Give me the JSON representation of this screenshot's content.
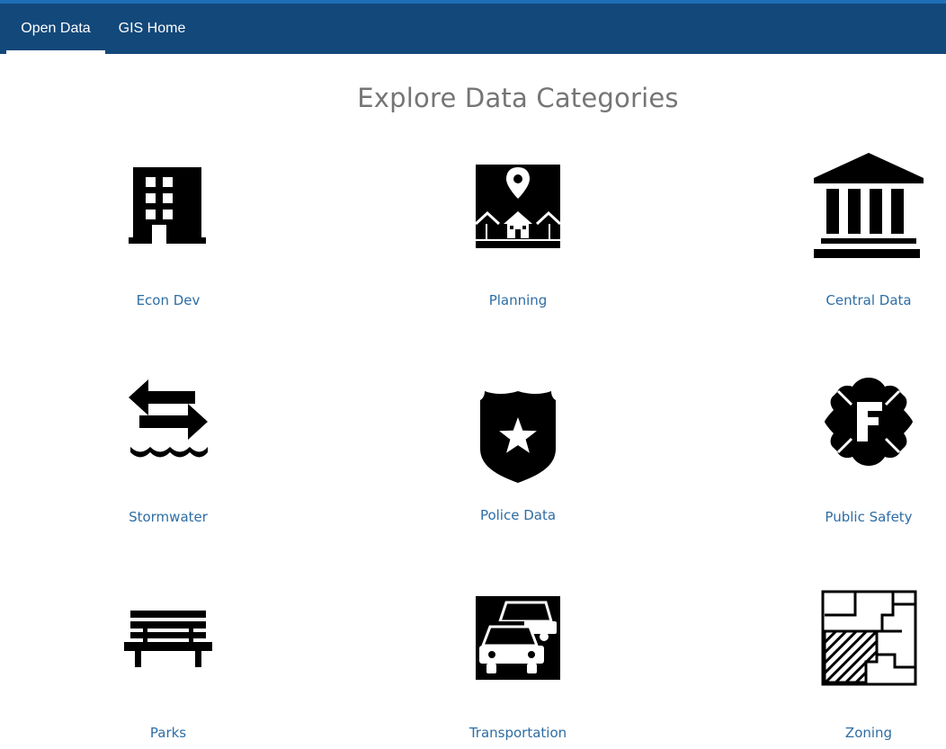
{
  "nav": {
    "items": [
      {
        "label": "Open Data",
        "active": true
      },
      {
        "label": "GIS Home",
        "active": false
      }
    ]
  },
  "main": {
    "title": "Explore Data Categories",
    "categories": [
      {
        "label": "Econ Dev",
        "icon": "office-building-icon"
      },
      {
        "label": "Planning",
        "icon": "map-pin-neighborhood-icon"
      },
      {
        "label": "Central Data",
        "icon": "government-building-icon"
      },
      {
        "label": "Stormwater",
        "icon": "water-flow-arrows-icon"
      },
      {
        "label": "Police Data",
        "icon": "police-badge-icon"
      },
      {
        "label": "Public Safety",
        "icon": "fire-department-badge-icon"
      },
      {
        "label": "Parks",
        "icon": "park-bench-icon"
      },
      {
        "label": "Transportation",
        "icon": "cars-icon"
      },
      {
        "label": "Zoning",
        "icon": "zoning-map-icon"
      }
    ]
  },
  "colors": {
    "header_bg": "#13487a",
    "header_accent": "#1d6fb8",
    "link": "#2e6da4",
    "title": "#757575"
  }
}
